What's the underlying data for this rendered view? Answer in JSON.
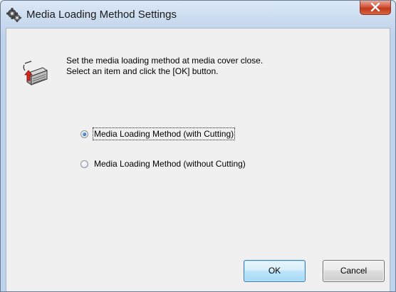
{
  "window": {
    "title": "Media Loading Method Settings",
    "title_icon": "gear-cog-icon",
    "close_icon": "close-icon",
    "close_button_color": "#c2371b"
  },
  "instructions": {
    "icon": "media-loading-icon",
    "line1": "Set the media loading method at media cover close.",
    "line2": "Select an item and click the [OK] button."
  },
  "options": [
    {
      "label": "Media Loading Method (with Cutting)",
      "selected": true
    },
    {
      "label": "Media Loading Method (without Cutting)",
      "selected": false
    }
  ],
  "buttons": {
    "ok_label": "OK",
    "cancel_label": "Cancel"
  }
}
